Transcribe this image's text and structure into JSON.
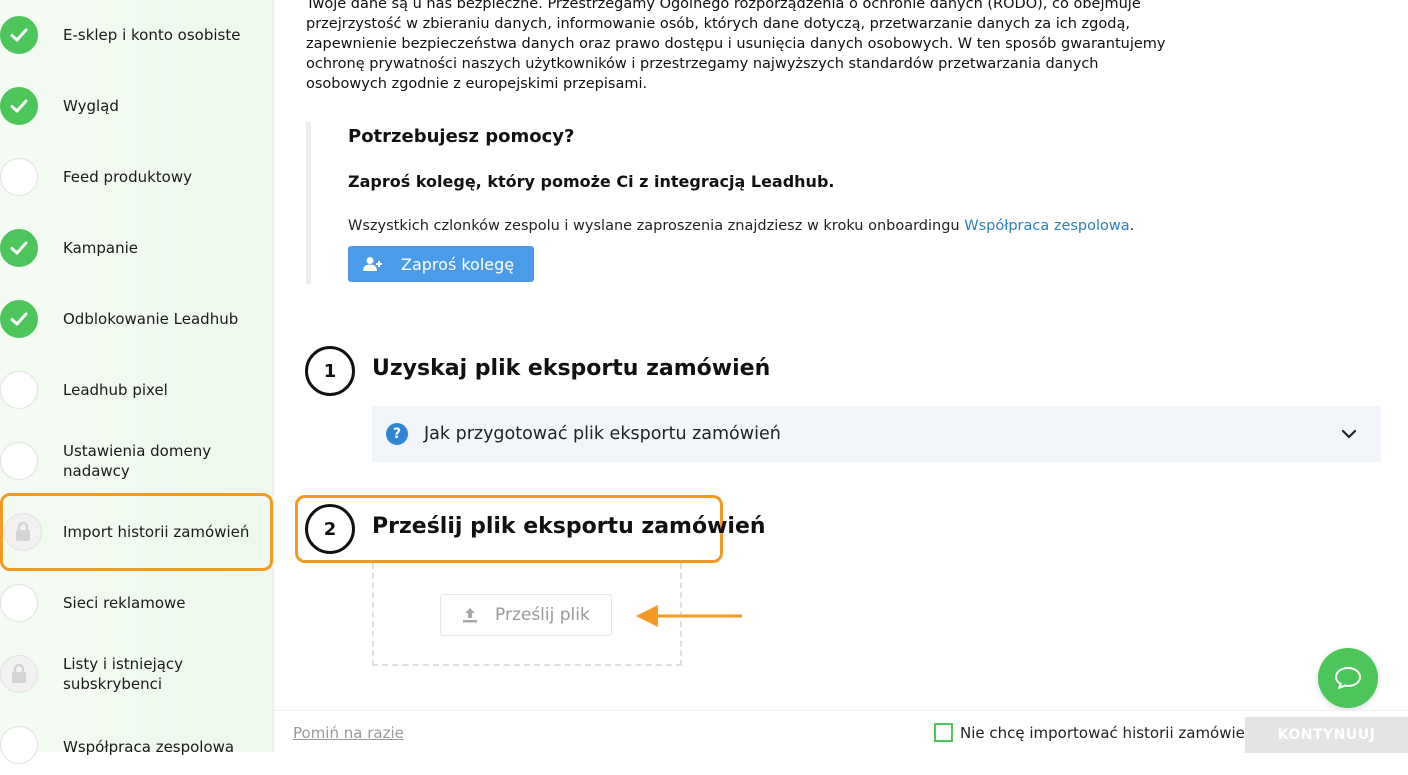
{
  "sidebar": {
    "steps": [
      {
        "label": "E-sklep i konto osobiste",
        "status": "done"
      },
      {
        "label": "Wygląd",
        "status": "done"
      },
      {
        "label": "Feed produktowy",
        "status": "todo"
      },
      {
        "label": "Kampanie",
        "status": "done"
      },
      {
        "label": "Odblokowanie Leadhub",
        "status": "done"
      },
      {
        "label": "Leadhub pixel",
        "status": "todo"
      },
      {
        "label": "Ustawienia domeny nadawcy",
        "status": "todo"
      },
      {
        "label": "Import historii zamówień",
        "status": "locked"
      },
      {
        "label": "Sieci reklamowe",
        "status": "todo"
      },
      {
        "label": "Listy i istniejący subskrybenci",
        "status": "locked"
      },
      {
        "label": "Współpraca zespolowa",
        "status": "todo"
      }
    ]
  },
  "main": {
    "intro": "Twoje dane są u nas bezpieczne. Przestrzegamy Ogólnego rozporządzenia o ochronie danych (RODO), co obejmuje przejrzystość w zbieraniu danych, informowanie osób, których dane dotyczą, przetwarzanie danych za ich zgodą, zapewnienie bezpieczeństwa danych oraz prawo dostępu i usunięcia danych osobowych. W ten sposób gwarantujemy ochronę prywatności naszych użytkowników i przestrzegamy najwyższych standardów przetwarzania danych osobowych zgodnie z europejskimi przepisami.",
    "help": {
      "title": "Potrzebujesz pomocy?",
      "subtitle": "Zaproś kolegę, który pomoże Ci z integracją Leadhub.",
      "text": "Wszystkich czlonków zespolu i wyslane zaproszenia znajdziesz w kroku onboardingu ",
      "link": "Współpraca zespolowa",
      "text_end": ".",
      "button": "Zaproś kolegę"
    },
    "step1": {
      "number": "1",
      "title": "Uzyskaj plik eksportu zamówień"
    },
    "accordion": {
      "label": "Jak przygotować plik eksportu zamówień"
    },
    "step2": {
      "number": "2",
      "title": "Prześlij plik eksportu zamówień"
    },
    "upload_button": "Prześlij plik"
  },
  "footer": {
    "skip": "Pomiń na razie",
    "checkbox_label": "Nie chcę importować historii zamówień",
    "checkbox_checked": false,
    "continue": "KONTYNUUJ"
  },
  "colors": {
    "accent_green": "#4cc55a",
    "highlight_orange": "#f39a23",
    "button_blue": "#4a9bea",
    "link_blue": "#2f7fbe"
  }
}
